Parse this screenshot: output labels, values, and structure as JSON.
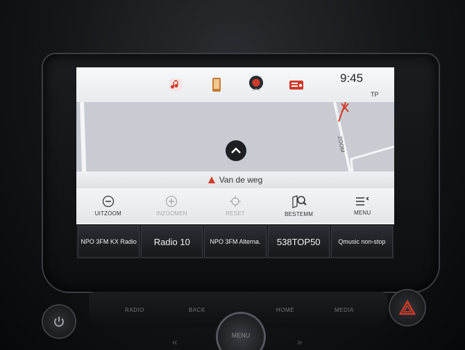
{
  "status": {
    "clock": "9:45",
    "tp": "TP"
  },
  "top_icons": [
    "music-icon",
    "phone-icon",
    "navigation-icon",
    "radio-icon"
  ],
  "map": {
    "road_label": "ZOOM",
    "street_name": "Van de weg"
  },
  "controls": [
    {
      "label": "UITZOOM",
      "icon": "zoom-out-icon",
      "enabled": true
    },
    {
      "label": "INZOOMEN",
      "icon": "zoom-in-icon",
      "enabled": false
    },
    {
      "label": "RESET",
      "icon": "reset-icon",
      "enabled": false
    },
    {
      "label": "BESTEMM",
      "icon": "destination-search-icon",
      "enabled": true
    },
    {
      "label": "MENU",
      "icon": "menu-icon",
      "enabled": true
    }
  ],
  "presets": [
    "NPO 3FM KX Radio",
    "Radio 10",
    "NPO 3FM Alterna.",
    "538TOP50",
    "Qmusic non-stop"
  ],
  "hardware": {
    "radio": "RADIO",
    "back": "BACK",
    "home": "HOME",
    "media": "MEDIA",
    "menu": "MENU",
    "prev": "«",
    "next": "»"
  },
  "colors": {
    "accent": "#d23a2a",
    "screen_bg": "#f4f5f7",
    "preset_bg": "#1b1d20"
  }
}
